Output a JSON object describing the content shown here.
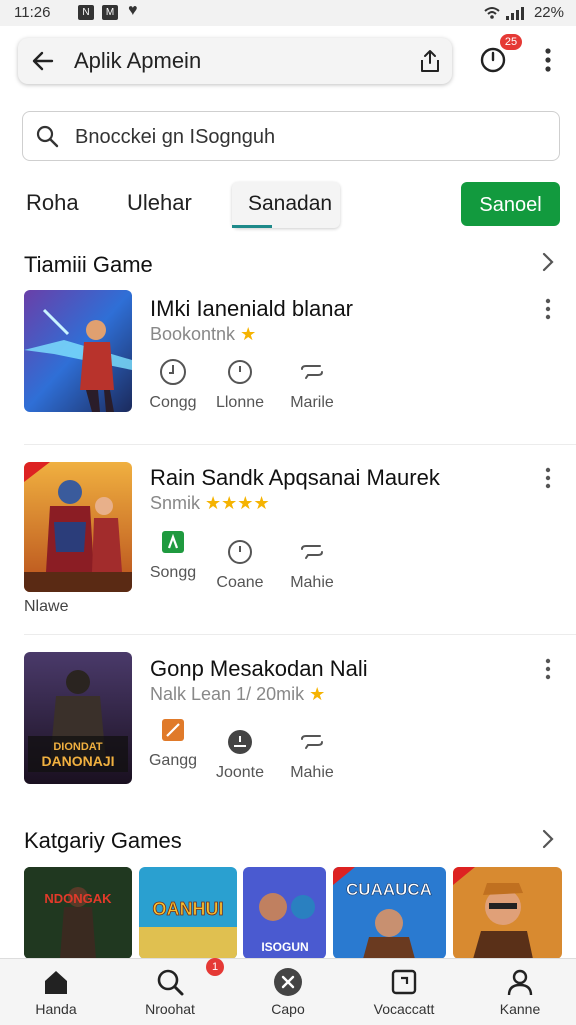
{
  "status": {
    "time": "11:26",
    "battery": "22%"
  },
  "header": {
    "title": "Aplik Apmein",
    "notif_count": "25"
  },
  "search": {
    "value": "Bnocckei gn ISognguh"
  },
  "tabs": [
    {
      "label": "Roha"
    },
    {
      "label": "Ulehar"
    },
    {
      "label": "Sanadan"
    }
  ],
  "primary_button": {
    "label": "Sanoel"
  },
  "featured": {
    "title": "Tiamiii Game",
    "items": [
      {
        "title": "IMki Ianeniald blanar",
        "subtitle": "Bookontnk",
        "stars": "★",
        "actions": [
          "Congg",
          "Llonne",
          "Marile"
        ],
        "caption": ""
      },
      {
        "title": "Rain Sandk Apqsanai Maurek",
        "subtitle": "Snmik",
        "stars": "★★★★",
        "actions": [
          "Songg",
          "Coane",
          "Mahie"
        ],
        "caption": "Nlawe"
      },
      {
        "title": "Gonp Mesakodan Nali",
        "subtitle": "Nalk Lean 1/ 20mik",
        "stars": "★",
        "actions": [
          "Gangg",
          "Joonte",
          "Mahie"
        ],
        "caption": ""
      }
    ],
    "thumb_texts": [
      "",
      "",
      "DIONDAT DANONAJI"
    ]
  },
  "categories": {
    "title": "Katgariy Games",
    "thumb_texts": [
      "NDONGAK",
      "OANHUI",
      "ISOGUN",
      "CUAAUCA",
      ""
    ]
  },
  "bottom_nav": [
    {
      "label": "Handa"
    },
    {
      "label": "Nroohat",
      "badge": "1"
    },
    {
      "label": "Capo"
    },
    {
      "label": "Vocaccatt"
    },
    {
      "label": "Kanne"
    }
  ],
  "colors": {
    "accent_green": "#129a3e",
    "badge_red": "#e53935",
    "tab_underline": "#1e8a8a",
    "star": "#f5b301"
  }
}
